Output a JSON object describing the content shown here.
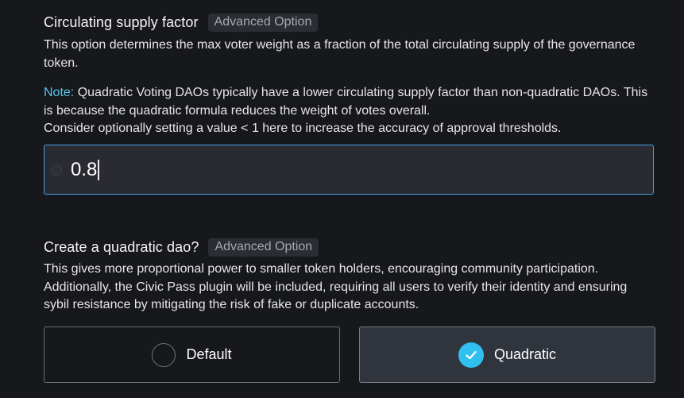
{
  "supply_section": {
    "title": "Circulating supply factor",
    "badge": "Advanced Option",
    "description": "This option determines the max voter weight as a fraction of the total circulating supply of the governance token.",
    "note_label": "Note:",
    "note_text": " Quadratic Voting DAOs typically have a lower circulating supply factor than non-quadratic DAOs. This is because the quadratic formula reduces the weight of votes overall.",
    "note_text_2": "Consider optionally setting a value < 1 here to increase the accuracy of approval thresholds.",
    "input": {
      "value": "0.8",
      "icon": "token-icon"
    }
  },
  "quadratic_section": {
    "title": "Create a quadratic dao?",
    "badge": "Advanced Option",
    "description": "This gives more proportional power to smaller token holders, encouraging community participation. Additionally, the Civic Pass plugin will be included, requiring all users to verify their identity and ensuring sybil resistance by mitigating the risk of fake or duplicate accounts.",
    "options": [
      {
        "label": "Default",
        "selected": false
      },
      {
        "label": "Quadratic",
        "selected": true
      }
    ]
  },
  "colors": {
    "background": "#17181c",
    "accent": "#3ea1e6",
    "note": "#5cc4ee",
    "check": "#2fc0f0"
  }
}
